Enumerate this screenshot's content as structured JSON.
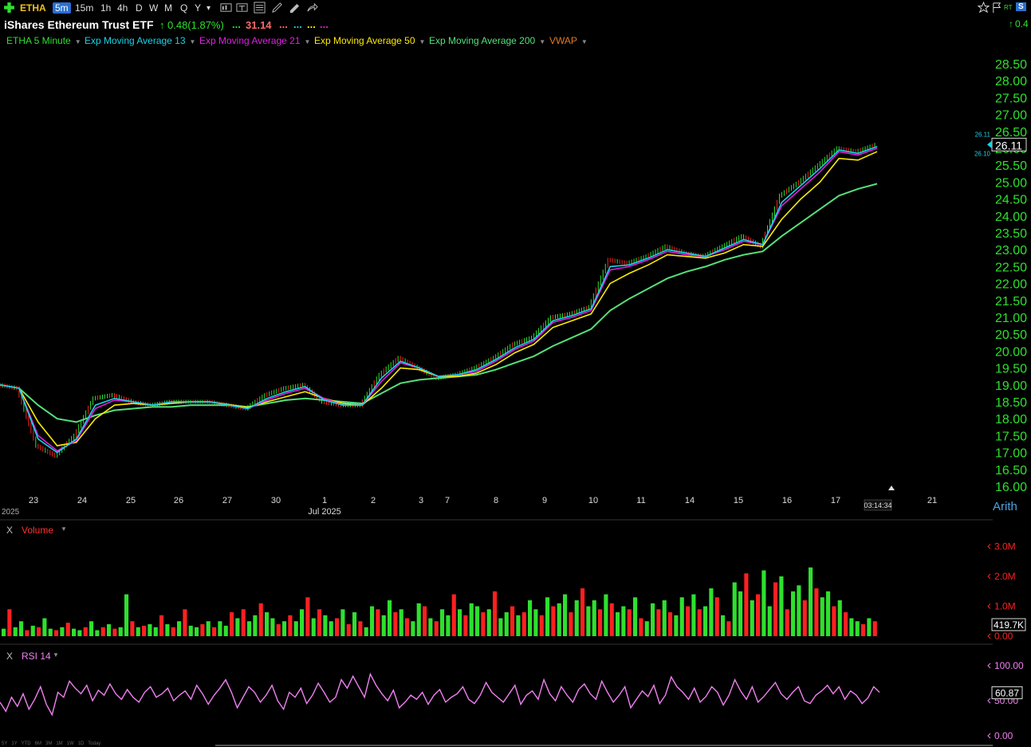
{
  "toolbar": {
    "symbol": "ETHA",
    "intervals": [
      "5m",
      "15m",
      "1h",
      "4h",
      "D",
      "W",
      "M",
      "Q",
      "Y"
    ],
    "active_interval": "5m",
    "caret": "▾"
  },
  "header": {
    "title": "iShares Ethereum Trust ETF",
    "change": "0.48(1.87%)",
    "dots_green": "...",
    "price_text": "31.14",
    "dots_red": "...",
    "dots_cyan": "...",
    "dots_yellow": "...",
    "dots_magenta": "...",
    "right_change": "0.4",
    "rt_label": "RT",
    "s_label": "S"
  },
  "legend": [
    {
      "label": "ETHA 5 Minute",
      "color": "#2ee02e"
    },
    {
      "label": "Exp Moving Average 13",
      "color": "#19d3e6"
    },
    {
      "label": "Exp Moving Average 21",
      "color": "#e020e0"
    },
    {
      "label": "Exp Moving Average 50",
      "color": "#ffea00"
    },
    {
      "label": "Exp Moving Average 200",
      "color": "#55e07a"
    },
    {
      "label": "VWAP",
      "color": "#e07a20"
    }
  ],
  "colors": {
    "up": "#2ee02e",
    "down": "#ff2020",
    "axis": "#2ee02e",
    "rsi": "#f080f0"
  },
  "chart_data": [
    {
      "type": "line",
      "title": "",
      "scale": "Arith",
      "ylim": [
        16.0,
        28.5
      ],
      "y_ticks": [
        "28.50",
        "28.00",
        "27.50",
        "27.00",
        "26.50",
        "26.00",
        "25.50",
        "25.00",
        "24.50",
        "24.00",
        "23.50",
        "23.00",
        "22.50",
        "22.00",
        "21.50",
        "21.00",
        "20.50",
        "20.00",
        "19.50",
        "19.00",
        "18.50",
        "18.00",
        "17.50",
        "17.00",
        "16.50",
        "16.00"
      ],
      "x_labels": [
        "23",
        "24",
        "25",
        "26",
        "27",
        "30",
        "1",
        "2",
        "3",
        "7",
        "8",
        "9",
        "10",
        "11",
        "14",
        "15",
        "16",
        "17",
        "21"
      ],
      "x_sub_label": "Jul 2025",
      "left_label": "2025",
      "time_label": "03:14:34",
      "last_price": "26.11",
      "small_labels": [
        "26.11",
        "26.10"
      ],
      "series": [
        {
          "name": "ETHA 5 Minute",
          "values": [
            19.0,
            18.9,
            17.2,
            16.9,
            17.5,
            18.6,
            18.7,
            18.5,
            18.4,
            18.5,
            18.5,
            18.5,
            18.4,
            18.3,
            18.7,
            18.9,
            19.0,
            18.5,
            18.4,
            18.4,
            19.3,
            19.8,
            19.5,
            19.2,
            19.3,
            19.5,
            19.8,
            20.2,
            20.4,
            21.0,
            21.1,
            21.3,
            22.7,
            22.6,
            22.8,
            23.1,
            22.9,
            22.8,
            23.1,
            23.4,
            23.1,
            24.6,
            25.0,
            25.5,
            26.0,
            25.9,
            26.1
          ]
        },
        {
          "name": "Exp Moving Average 13",
          "values": [
            19.0,
            18.9,
            17.4,
            17.0,
            17.4,
            18.4,
            18.6,
            18.5,
            18.4,
            18.5,
            18.5,
            18.5,
            18.4,
            18.3,
            18.6,
            18.8,
            18.95,
            18.55,
            18.4,
            18.4,
            19.2,
            19.7,
            19.5,
            19.25,
            19.3,
            19.45,
            19.75,
            20.1,
            20.35,
            20.9,
            21.05,
            21.25,
            22.5,
            22.55,
            22.75,
            23.0,
            22.9,
            22.8,
            23.05,
            23.3,
            23.15,
            24.4,
            24.9,
            25.4,
            25.95,
            25.85,
            26.05
          ]
        },
        {
          "name": "Exp Moving Average 21",
          "values": [
            19.0,
            18.9,
            17.5,
            17.05,
            17.35,
            18.3,
            18.55,
            18.5,
            18.4,
            18.5,
            18.5,
            18.5,
            18.4,
            18.3,
            18.55,
            18.75,
            18.9,
            18.6,
            18.4,
            18.4,
            19.1,
            19.65,
            19.5,
            19.25,
            19.3,
            19.4,
            19.7,
            20.05,
            20.3,
            20.85,
            21.0,
            21.2,
            22.4,
            22.5,
            22.7,
            22.95,
            22.85,
            22.8,
            23.0,
            23.25,
            23.15,
            24.3,
            24.8,
            25.3,
            25.9,
            25.8,
            26.0
          ]
        },
        {
          "name": "Exp Moving Average 50",
          "values": [
            19.0,
            18.9,
            17.9,
            17.2,
            17.3,
            18.0,
            18.4,
            18.45,
            18.4,
            18.45,
            18.5,
            18.5,
            18.42,
            18.33,
            18.5,
            18.65,
            18.8,
            18.6,
            18.45,
            18.4,
            18.9,
            19.5,
            19.45,
            19.25,
            19.25,
            19.35,
            19.6,
            19.95,
            20.2,
            20.7,
            20.9,
            21.1,
            22.0,
            22.3,
            22.55,
            22.85,
            22.8,
            22.75,
            22.9,
            23.15,
            23.1,
            23.9,
            24.5,
            25.0,
            25.7,
            25.65,
            25.9
          ]
        },
        {
          "name": "Exp Moving Average 200",
          "values": [
            null,
            18.9,
            18.4,
            18.0,
            17.9,
            18.1,
            18.25,
            18.3,
            18.35,
            18.35,
            18.4,
            18.4,
            18.4,
            18.35,
            18.45,
            18.55,
            18.6,
            18.55,
            18.5,
            18.45,
            18.75,
            19.05,
            19.15,
            19.2,
            19.25,
            19.3,
            19.45,
            19.65,
            19.85,
            20.15,
            20.4,
            20.65,
            21.2,
            21.55,
            21.85,
            22.15,
            22.35,
            22.5,
            22.7,
            22.85,
            22.95,
            23.4,
            23.8,
            24.2,
            24.6,
            24.8,
            24.95
          ]
        }
      ]
    },
    {
      "type": "bar",
      "title": "Volume",
      "ylim": [
        0,
        3200000
      ],
      "y_ticks": [
        "3.0M",
        "2.0M",
        "1.0M",
        "0.00"
      ],
      "last_value": "419.7K",
      "values": [
        0.25,
        0.9,
        0.3,
        0.5,
        0.2,
        0.35,
        0.3,
        0.6,
        0.25,
        0.2,
        0.3,
        0.45,
        0.25,
        0.2,
        0.3,
        0.5,
        0.2,
        0.3,
        0.4,
        0.25,
        0.3,
        1.4,
        0.5,
        0.3,
        0.35,
        0.4,
        0.3,
        0.7,
        0.4,
        0.3,
        0.5,
        0.9,
        0.35,
        0.3,
        0.4,
        0.5,
        0.3,
        0.5,
        0.35,
        0.8,
        0.6,
        0.9,
        0.5,
        0.7,
        1.1,
        0.8,
        0.6,
        0.4,
        0.5,
        0.7,
        0.5,
        0.9,
        1.3,
        0.6,
        0.9,
        0.7,
        0.5,
        0.6,
        0.9,
        0.4,
        0.8,
        0.5,
        0.3,
        1.0,
        0.9,
        0.7,
        1.2,
        0.8,
        0.9,
        0.6,
        0.5,
        1.1,
        1.0,
        0.6,
        0.5,
        0.9,
        0.7,
        1.4,
        0.9,
        0.7,
        1.1,
        1.0,
        0.8,
        0.9,
        1.5,
        0.6,
        0.8,
        1.0,
        0.7,
        0.8,
        1.2,
        0.9,
        0.7,
        1.3,
        1.0,
        1.1,
        1.4,
        0.8,
        1.2,
        1.6,
        1.0,
        1.2,
        0.9,
        1.4,
        1.1,
        0.8,
        1.0,
        0.9,
        1.3,
        0.6,
        0.5,
        1.1,
        0.9,
        1.2,
        0.8,
        0.7,
        1.3,
        1.0,
        1.4,
        0.9,
        1.0,
        1.6,
        1.3,
        0.7,
        0.5,
        1.8,
        1.5,
        2.1,
        1.2,
        1.4,
        2.2,
        1.0,
        1.8,
        2.0,
        0.9,
        1.5,
        1.7,
        1.2,
        2.3,
        1.6,
        1.3,
        1.5,
        1.0,
        1.2,
        0.8,
        0.6,
        0.5,
        0.4,
        0.6,
        0.5
      ],
      "up": [
        1,
        0,
        1,
        1,
        0,
        1,
        0,
        1,
        1,
        0,
        1,
        0,
        1,
        1,
        0,
        1,
        1,
        0,
        1,
        0,
        1,
        1,
        0,
        1,
        0,
        1,
        1,
        0,
        1,
        0,
        1,
        0,
        1,
        1,
        0,
        1,
        0,
        1,
        1,
        0,
        1,
        0,
        1,
        1,
        0,
        1,
        1,
        0,
        1,
        0,
        1,
        1,
        0,
        1,
        0,
        1,
        1,
        0,
        1,
        0,
        1,
        0,
        1,
        1,
        0,
        1,
        1,
        0,
        1,
        0,
        1,
        1,
        0,
        1,
        0,
        1,
        1,
        0,
        1,
        0,
        1,
        1,
        0,
        1,
        0,
        1,
        1,
        0,
        1,
        0,
        1,
        1,
        0,
        1,
        0,
        1,
        1,
        0,
        1,
        0,
        1,
        1,
        0,
        1,
        0,
        1,
        1,
        0,
        1,
        0,
        1,
        1,
        0,
        1,
        0,
        1,
        1,
        0,
        1,
        0,
        1,
        1,
        0,
        1,
        0,
        1,
        1,
        0,
        1,
        0,
        1,
        1,
        0,
        1,
        0,
        1,
        1,
        0,
        1,
        0,
        1,
        1,
        0,
        1,
        0,
        1,
        1,
        0,
        1,
        0,
        1,
        1
      ]
    },
    {
      "type": "line",
      "title": "RSI 14",
      "ylim": [
        0,
        100
      ],
      "y_ticks": [
        "100.00",
        "50.00",
        "0.00"
      ],
      "last_value": "60.87",
      "values": [
        48,
        35,
        55,
        42,
        60,
        38,
        52,
        70,
        45,
        30,
        62,
        55,
        78,
        68,
        60,
        72,
        50,
        65,
        58,
        74,
        60,
        52,
        66,
        55,
        48,
        62,
        70,
        55,
        60,
        68,
        50,
        58,
        64,
        52,
        72,
        60,
        45,
        58,
        68,
        80,
        62,
        40,
        55,
        70,
        62,
        48,
        58,
        72,
        50,
        38,
        62,
        55,
        68,
        46,
        58,
        75,
        62,
        48,
        55,
        80,
        68,
        85,
        70,
        55,
        88,
        72,
        60,
        50,
        65,
        40,
        48,
        58,
        52,
        62,
        45,
        58,
        66,
        48,
        55,
        60,
        70,
        52,
        46,
        58,
        76,
        62,
        55,
        48,
        60,
        72,
        45,
        58,
        64,
        52,
        80,
        60,
        50,
        70,
        58,
        48,
        66,
        74,
        60,
        52,
        78,
        62,
        48,
        58,
        70,
        40,
        52,
        64,
        56,
        72,
        46,
        58,
        84,
        70,
        62,
        52,
        68,
        48,
        56,
        70,
        62,
        44,
        58,
        80,
        64,
        52,
        70,
        48,
        56,
        66,
        76,
        60,
        52,
        62,
        70,
        50,
        46,
        58,
        64,
        72,
        60,
        70,
        52,
        64,
        58,
        46,
        54,
        70,
        62
      ]
    }
  ],
  "axis_label": "Arith",
  "pane_close": "X",
  "footer_ranges": [
    "5Y",
    "1Y",
    "YTD",
    "6M",
    "3M",
    "1M",
    "1W",
    "1D",
    "Today"
  ]
}
